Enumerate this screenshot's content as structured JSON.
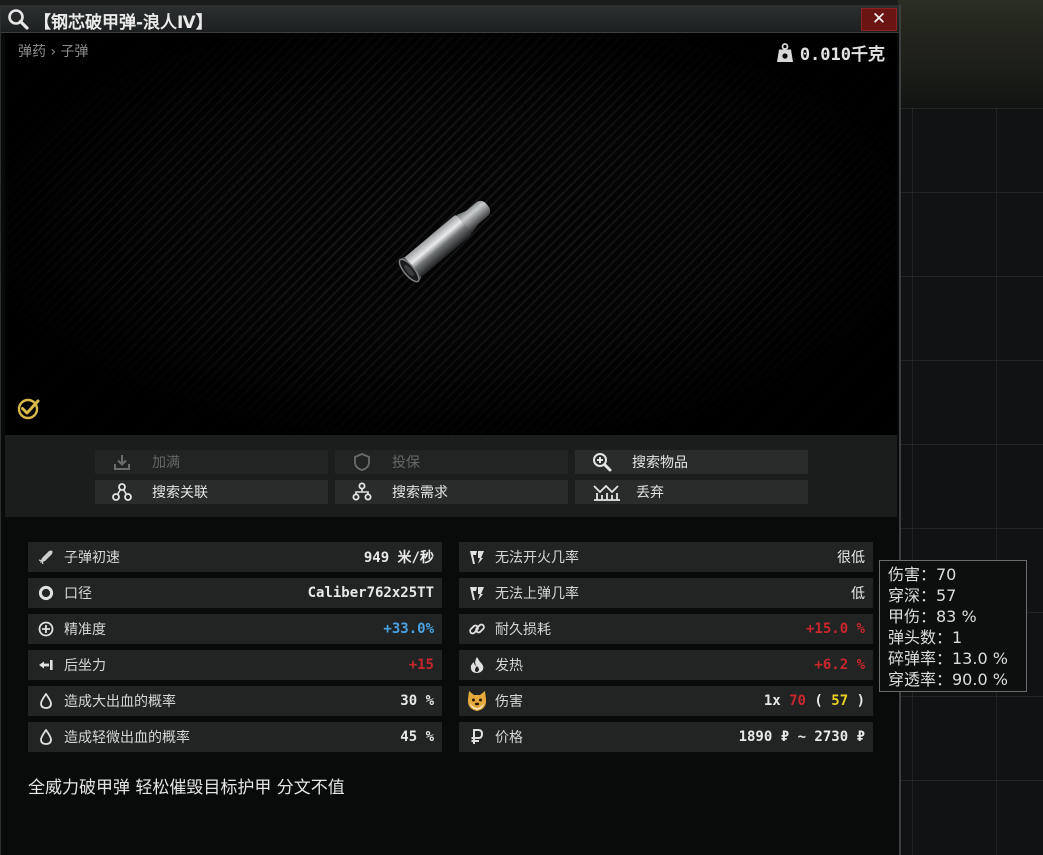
{
  "window": {
    "title": "【钢芯破甲弹-浪人Ⅳ】",
    "close_label": "✕"
  },
  "item": {
    "breadcrumb": "弹药 › 子弹",
    "weight": "0.010千克",
    "description": "全威力破甲弹 轻松催毁目标护甲 分文不值"
  },
  "actions": [
    {
      "label": "加满",
      "icon": "download-icon",
      "enabled": false
    },
    {
      "label": "投保",
      "icon": "shield-icon",
      "enabled": false
    },
    {
      "label": "搜索物品",
      "icon": "magnifier-plus-icon",
      "enabled": true
    },
    {
      "label": "搜索关联",
      "icon": "linked-nodes-icon",
      "enabled": true
    },
    {
      "label": "搜索需求",
      "icon": "required-nodes-icon",
      "enabled": true
    },
    {
      "label": "丢弃",
      "icon": "discard-icon",
      "enabled": true
    }
  ],
  "stats_left": [
    {
      "label": "子弹初速",
      "value": "949 米/秒",
      "icon": "bullet-velocity-icon"
    },
    {
      "label": "口径",
      "value": "Caliber762x25TT",
      "icon": "caliber-ring-icon"
    },
    {
      "label": "精准度",
      "value": "+33.0%",
      "icon": "crosshair-icon",
      "color": "#4aa3e0"
    },
    {
      "label": "后坐力",
      "value": "+15",
      "icon": "recoil-icon",
      "color": "#c9272d"
    },
    {
      "label": "造成大出血的概率",
      "value": "30 %",
      "icon": "blood-drop-icon"
    },
    {
      "label": "造成轻微出血的概率",
      "value": "45 %",
      "icon": "blood-drop-icon"
    }
  ],
  "stats_right": [
    {
      "label": "无法开火几率",
      "value": "很低",
      "icon": "malfunction-icon"
    },
    {
      "label": "无法上弹几率",
      "value": "低",
      "icon": "malfunction-icon"
    },
    {
      "label": "耐久损耗",
      "value": "+15.0 %",
      "icon": "chain-link-icon",
      "color": "#c9272d"
    },
    {
      "label": "发热",
      "value": "+6.2 %",
      "icon": "flame-icon",
      "color": "#c9272d"
    },
    {
      "label": "伤害",
      "icon": "doge-face-icon",
      "damage": {
        "prefix": "1x ",
        "value": "70",
        "open": " ( ",
        "armor": "57",
        "close": " )"
      }
    },
    {
      "label": "价格",
      "value": "1890 ₽ ~ 2730 ₽",
      "icon": "ruble-icon"
    }
  ],
  "tooltip": [
    "伤害：70",
    "穿深：57",
    "甲伤：83 %",
    "弹头数：1",
    "碎弹率：13.0 %",
    "穿透率：90.0 %"
  ],
  "colors": {
    "accent_blue": "#4aa3e0",
    "accent_red": "#c9272d",
    "accent_yellow": "#e8d027",
    "check_gold": "#d9b94a",
    "close_red": "#6a1414"
  }
}
